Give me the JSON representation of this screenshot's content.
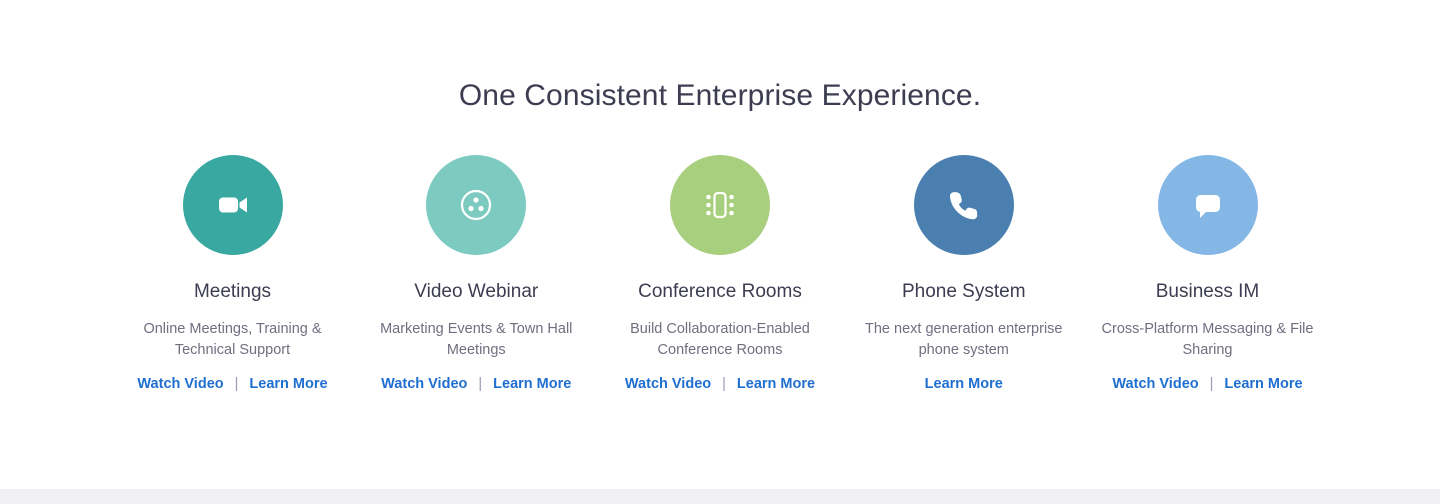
{
  "heading": "One Consistent Enterprise Experience.",
  "colors": {
    "heading_text": "#3d3d52",
    "body_text": "#6f6f80",
    "link_blue": "#1f6fd0",
    "separator_gray": "#9a9aad",
    "bottom_band": "#f0f0f5",
    "page_background": "#ffffff"
  },
  "link_separator": "|",
  "features": [
    {
      "icon": "video-camera-icon",
      "icon_color": "#38a8a0",
      "title": "Meetings",
      "description": "Online Meetings, Training & Technical Support",
      "watch_video_label": "Watch Video",
      "learn_more_label": "Learn More"
    },
    {
      "icon": "webinar-broadcast-icon",
      "icon_color": "#7ccac0",
      "title": "Video Webinar",
      "description": "Marketing Events & Town Hall Meetings",
      "watch_video_label": "Watch Video",
      "learn_more_label": "Learn More"
    },
    {
      "icon": "conference-room-icon",
      "icon_color": "#a8cf7d",
      "title": "Conference Rooms",
      "description": "Build Collaboration-Enabled Conference Rooms",
      "watch_video_label": "Watch Video",
      "learn_more_label": "Learn More"
    },
    {
      "icon": "phone-handset-icon",
      "icon_color": "#4a7fb0",
      "title": "Phone System",
      "description": "The next generation enterprise phone system",
      "watch_video_label": null,
      "learn_more_label": "Learn More"
    },
    {
      "icon": "chat-bubble-icon",
      "icon_color": "#84b7e6",
      "title": "Business IM",
      "description": "Cross-Platform Messaging & File Sharing",
      "watch_video_label": "Watch Video",
      "learn_more_label": "Learn More"
    }
  ]
}
